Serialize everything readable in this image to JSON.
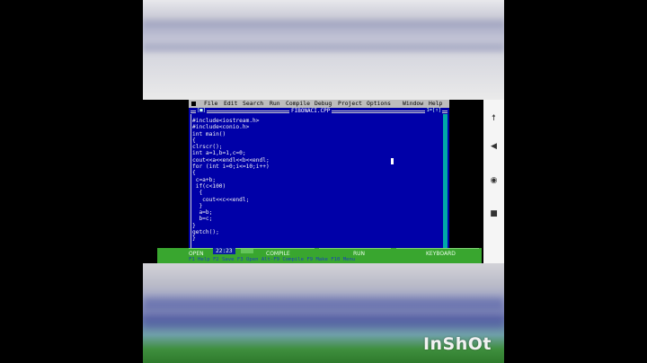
{
  "menu": {
    "items": [
      "File",
      "Edit",
      "Search",
      "Run",
      "Compile",
      "Debug",
      "Project",
      "Options",
      "Window",
      "Help"
    ]
  },
  "editor": {
    "close_box": "[■]",
    "title": "FIBONACI.CPP",
    "window_number": "1=[↑]",
    "code_lines": [
      "#include<iostream.h>",
      "#include<conio.h>",
      "int main()",
      "{",
      "clrscr();",
      "int a=1,b=1,c=0;",
      "cout<<a<<endl<<b<<endl;",
      "for (int i=0;i<=10;i++)",
      "{",
      " c=a+b;",
      " if(c<100)",
      "  {",
      "   cout<<c<<endl;",
      "  }",
      "  a=b;",
      "  b=c;",
      "}",
      "getch();",
      "}"
    ]
  },
  "overlay": {
    "clock": "22:23",
    "buttons": [
      "OPEN",
      "COMPILE",
      "RUN",
      "KEYBOARD"
    ]
  },
  "status_line": "F1 Help  F2 Save  F3 Open  Alt-F9 Compile  F9 Make  F10 Menu",
  "watermark": "InShOt",
  "colors": {
    "editor_background": "#0000a8",
    "menu_background": "#bdbdbd",
    "overlay_bar": "#39a62f"
  },
  "phone_nav": {
    "icons": [
      "accessibility-icon",
      "back-icon",
      "home-icon",
      "recents-icon"
    ]
  }
}
